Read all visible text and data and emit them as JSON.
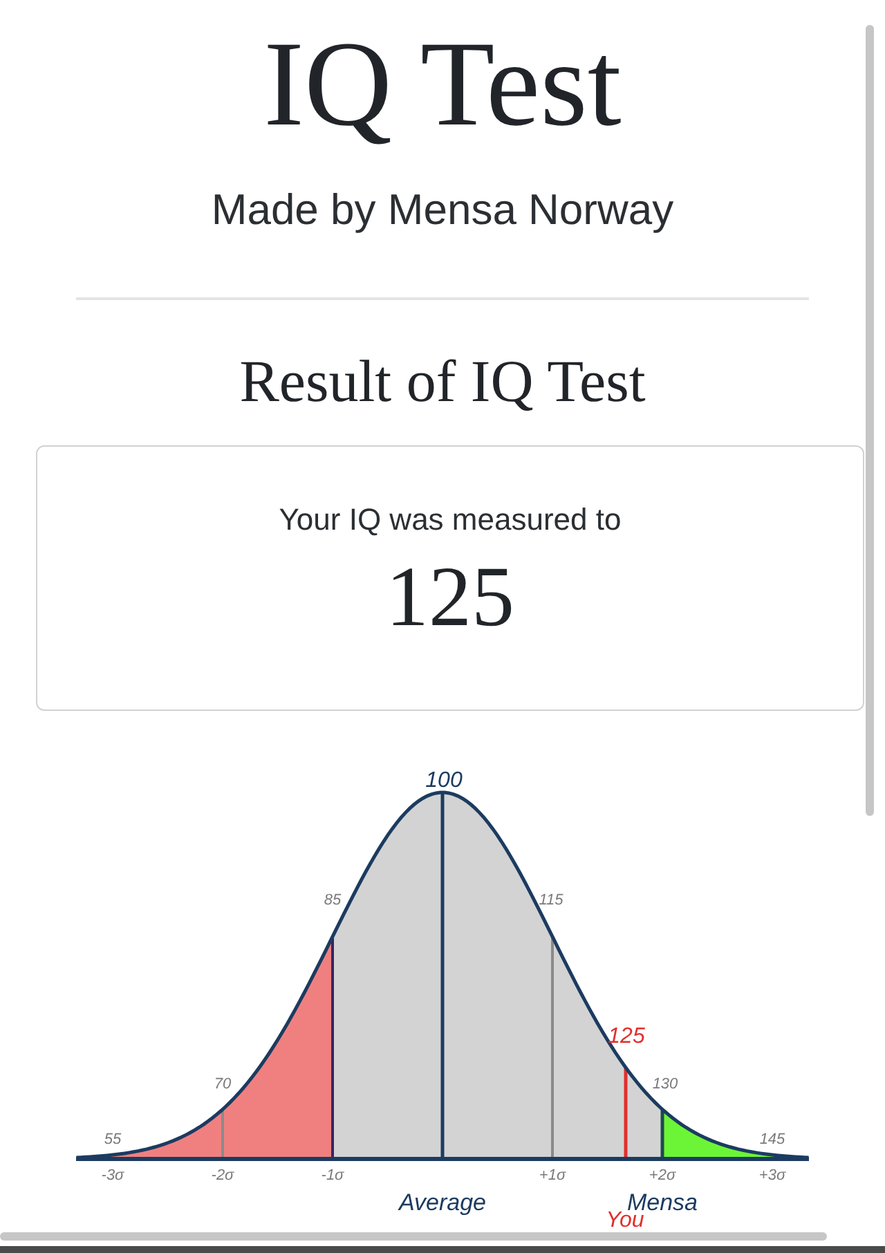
{
  "header": {
    "title": "IQ Test",
    "subtitle": "Made by Mensa Norway"
  },
  "result": {
    "heading": "Result of IQ Test",
    "caption": "Your IQ was measured to",
    "score": "125"
  },
  "bell_curve": {
    "peak_label": "100",
    "iq_labels": [
      "55",
      "70",
      "85",
      "115",
      "130",
      "145"
    ],
    "sigma_labels": [
      "-3σ",
      "-2σ",
      "-1σ",
      "+1σ",
      "+2σ",
      "+3σ"
    ],
    "average_label": "Average",
    "mensa_label": "Mensa",
    "your_score_label": "125",
    "you_label": "You"
  }
}
